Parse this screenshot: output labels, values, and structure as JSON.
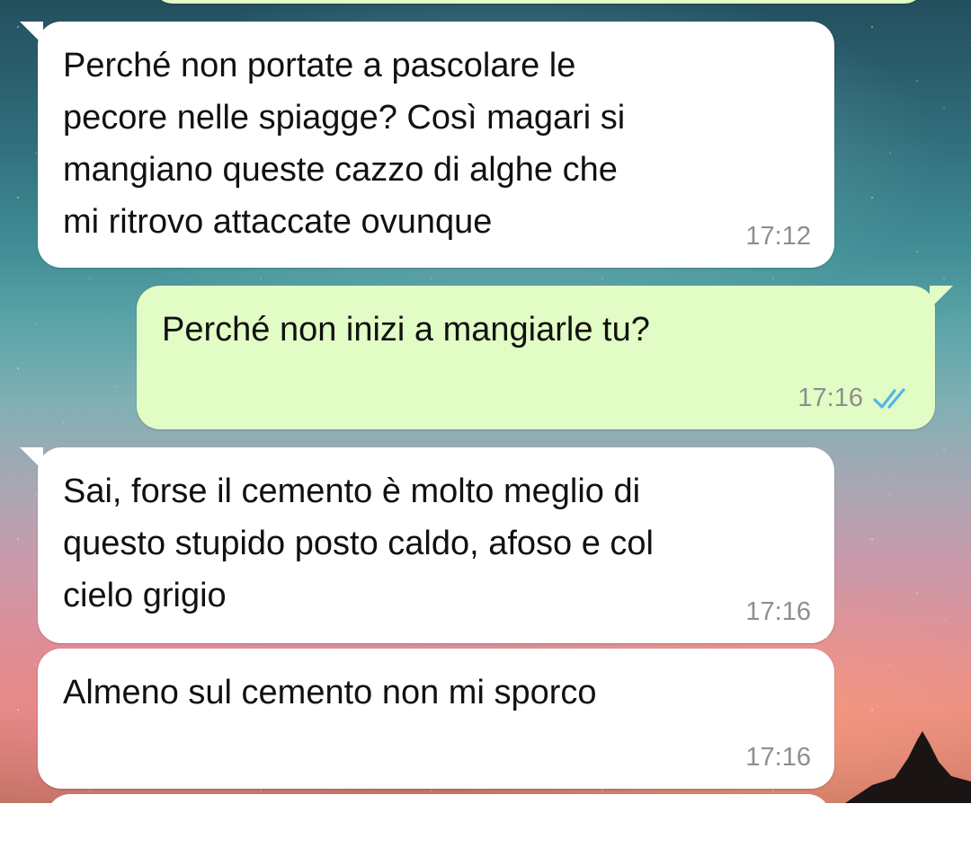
{
  "messages": [
    {
      "direction": "incoming",
      "text": "Perché non portate a pascolare le\npecore nelle spiagge? Così magari si\nmangiano queste cazzo di alghe che\nmi ritrovo attaccate ovunque",
      "time": "17:12"
    },
    {
      "direction": "outgoing",
      "text": "Perché non inizi a mangiarle tu?",
      "time": "17:16",
      "status": "read",
      "status_icon": "double-check-icon"
    },
    {
      "direction": "incoming",
      "text": "Sai, forse il cemento è molto meglio di\nquesto stupido posto caldo, afoso e col\ncielo grigio",
      "time": "17:16"
    },
    {
      "direction": "incoming",
      "text": "Almeno sul cemento non mi sporco",
      "time": "17:16"
    }
  ],
  "colors": {
    "incoming_bubble": "#ffffff",
    "outgoing_bubble": "#e2fcc6",
    "timestamp": "#8e8e8e",
    "read_check": "#4fb6ec"
  }
}
